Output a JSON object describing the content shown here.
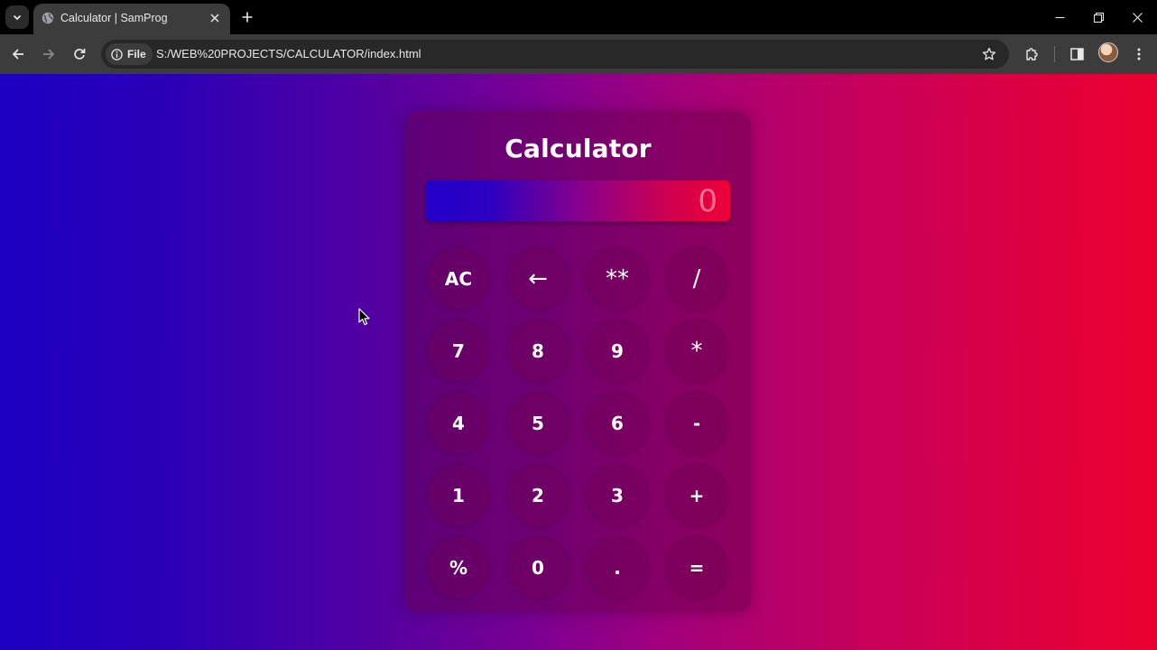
{
  "browser": {
    "tab_title": "Calculator | SamProg",
    "site_chip_label": "File",
    "url": "S:/WEB%20PROJECTS/CALCULATOR/index.html"
  },
  "icons": {
    "tab_list": "chevron-down-icon",
    "favicon": "globe-icon",
    "tab_close": "close-icon",
    "new_tab": "plus-icon",
    "minimize": "minimize-icon",
    "restore": "restore-icon",
    "close_window": "close-icon",
    "back": "arrow-left-icon",
    "forward": "arrow-right-icon",
    "reload": "reload-icon",
    "info": "info-icon",
    "bookmark": "star-icon",
    "extensions": "puzzle-icon",
    "side_panel": "side-panel-icon",
    "menu": "more-vert-icon"
  },
  "calculator": {
    "title": "Calculator",
    "display_value": "0",
    "keys": [
      [
        "AC",
        "←",
        "**",
        "/"
      ],
      [
        "7",
        "8",
        "9",
        "*"
      ],
      [
        "4",
        "5",
        "6",
        "-"
      ],
      [
        "1",
        "2",
        "3",
        "+"
      ],
      [
        "%",
        "0",
        ".",
        "="
      ]
    ]
  },
  "colors": {
    "page_gradient_start": "#1d00c3",
    "page_gradient_end": "#ea0030",
    "display_text": "#ff6e91"
  }
}
